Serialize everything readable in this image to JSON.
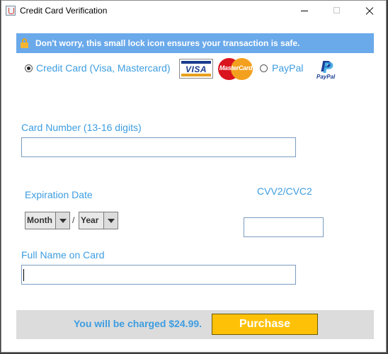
{
  "window": {
    "title": "Credit Card Verification",
    "icon": "java-cup-icon"
  },
  "notice": {
    "text": "Don't worry, this small lock icon ensures your transaction is safe.",
    "icon": "lock-icon",
    "background": "#6aa9ea"
  },
  "payment": {
    "credit_label": "Credit Card (Visa, Mastercard)",
    "credit_selected": true,
    "paypal_label": "PayPal",
    "paypal_selected": false,
    "logos": {
      "visa": "VISA",
      "mastercard": "MasterCard",
      "paypal": "PayPal"
    }
  },
  "card_number": {
    "label": "Card Number (13-16 digits)",
    "value": ""
  },
  "expiration": {
    "label": "Expiration Date",
    "month_value": "Month",
    "separator": "/",
    "year_value": "Year"
  },
  "cvv": {
    "label": "CVV2/CVC2",
    "value": ""
  },
  "full_name": {
    "label": "Full Name on Card",
    "value": ""
  },
  "footer": {
    "charge_text": "You will be charged $24.99.",
    "purchase_label": "Purchase"
  },
  "colors": {
    "accent_blue": "#3d9de0",
    "purchase_button": "#ffc107"
  }
}
